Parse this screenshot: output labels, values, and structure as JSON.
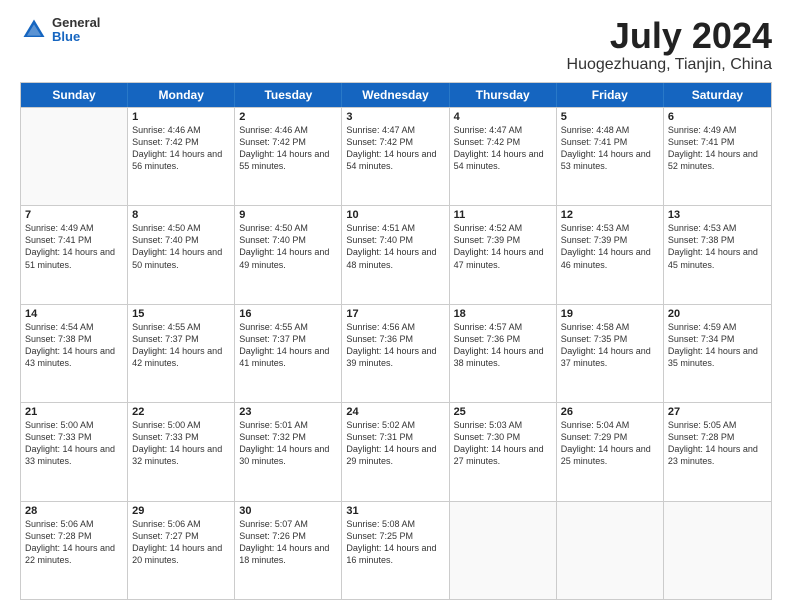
{
  "header": {
    "logo": {
      "general": "General",
      "blue": "Blue"
    },
    "title": "July 2024",
    "subtitle": "Huogezhuang, Tianjin, China"
  },
  "calendar": {
    "days": [
      "Sunday",
      "Monday",
      "Tuesday",
      "Wednesday",
      "Thursday",
      "Friday",
      "Saturday"
    ],
    "weeks": [
      [
        {
          "day": null,
          "sunrise": null,
          "sunset": null,
          "daylight": null
        },
        {
          "day": "1",
          "sunrise": "4:46 AM",
          "sunset": "7:42 PM",
          "daylight": "14 hours and 56 minutes."
        },
        {
          "day": "2",
          "sunrise": "4:46 AM",
          "sunset": "7:42 PM",
          "daylight": "14 hours and 55 minutes."
        },
        {
          "day": "3",
          "sunrise": "4:47 AM",
          "sunset": "7:42 PM",
          "daylight": "14 hours and 54 minutes."
        },
        {
          "day": "4",
          "sunrise": "4:47 AM",
          "sunset": "7:42 PM",
          "daylight": "14 hours and 54 minutes."
        },
        {
          "day": "5",
          "sunrise": "4:48 AM",
          "sunset": "7:41 PM",
          "daylight": "14 hours and 53 minutes."
        },
        {
          "day": "6",
          "sunrise": "4:49 AM",
          "sunset": "7:41 PM",
          "daylight": "14 hours and 52 minutes."
        }
      ],
      [
        {
          "day": "7",
          "sunrise": "4:49 AM",
          "sunset": "7:41 PM",
          "daylight": "14 hours and 51 minutes."
        },
        {
          "day": "8",
          "sunrise": "4:50 AM",
          "sunset": "7:40 PM",
          "daylight": "14 hours and 50 minutes."
        },
        {
          "day": "9",
          "sunrise": "4:50 AM",
          "sunset": "7:40 PM",
          "daylight": "14 hours and 49 minutes."
        },
        {
          "day": "10",
          "sunrise": "4:51 AM",
          "sunset": "7:40 PM",
          "daylight": "14 hours and 48 minutes."
        },
        {
          "day": "11",
          "sunrise": "4:52 AM",
          "sunset": "7:39 PM",
          "daylight": "14 hours and 47 minutes."
        },
        {
          "day": "12",
          "sunrise": "4:53 AM",
          "sunset": "7:39 PM",
          "daylight": "14 hours and 46 minutes."
        },
        {
          "day": "13",
          "sunrise": "4:53 AM",
          "sunset": "7:38 PM",
          "daylight": "14 hours and 45 minutes."
        }
      ],
      [
        {
          "day": "14",
          "sunrise": "4:54 AM",
          "sunset": "7:38 PM",
          "daylight": "14 hours and 43 minutes."
        },
        {
          "day": "15",
          "sunrise": "4:55 AM",
          "sunset": "7:37 PM",
          "daylight": "14 hours and 42 minutes."
        },
        {
          "day": "16",
          "sunrise": "4:55 AM",
          "sunset": "7:37 PM",
          "daylight": "14 hours and 41 minutes."
        },
        {
          "day": "17",
          "sunrise": "4:56 AM",
          "sunset": "7:36 PM",
          "daylight": "14 hours and 39 minutes."
        },
        {
          "day": "18",
          "sunrise": "4:57 AM",
          "sunset": "7:36 PM",
          "daylight": "14 hours and 38 minutes."
        },
        {
          "day": "19",
          "sunrise": "4:58 AM",
          "sunset": "7:35 PM",
          "daylight": "14 hours and 37 minutes."
        },
        {
          "day": "20",
          "sunrise": "4:59 AM",
          "sunset": "7:34 PM",
          "daylight": "14 hours and 35 minutes."
        }
      ],
      [
        {
          "day": "21",
          "sunrise": "5:00 AM",
          "sunset": "7:33 PM",
          "daylight": "14 hours and 33 minutes."
        },
        {
          "day": "22",
          "sunrise": "5:00 AM",
          "sunset": "7:33 PM",
          "daylight": "14 hours and 32 minutes."
        },
        {
          "day": "23",
          "sunrise": "5:01 AM",
          "sunset": "7:32 PM",
          "daylight": "14 hours and 30 minutes."
        },
        {
          "day": "24",
          "sunrise": "5:02 AM",
          "sunset": "7:31 PM",
          "daylight": "14 hours and 29 minutes."
        },
        {
          "day": "25",
          "sunrise": "5:03 AM",
          "sunset": "7:30 PM",
          "daylight": "14 hours and 27 minutes."
        },
        {
          "day": "26",
          "sunrise": "5:04 AM",
          "sunset": "7:29 PM",
          "daylight": "14 hours and 25 minutes."
        },
        {
          "day": "27",
          "sunrise": "5:05 AM",
          "sunset": "7:28 PM",
          "daylight": "14 hours and 23 minutes."
        }
      ],
      [
        {
          "day": "28",
          "sunrise": "5:06 AM",
          "sunset": "7:28 PM",
          "daylight": "14 hours and 22 minutes."
        },
        {
          "day": "29",
          "sunrise": "5:06 AM",
          "sunset": "7:27 PM",
          "daylight": "14 hours and 20 minutes."
        },
        {
          "day": "30",
          "sunrise": "5:07 AM",
          "sunset": "7:26 PM",
          "daylight": "14 hours and 18 minutes."
        },
        {
          "day": "31",
          "sunrise": "5:08 AM",
          "sunset": "7:25 PM",
          "daylight": "14 hours and 16 minutes."
        },
        {
          "day": null,
          "sunrise": null,
          "sunset": null,
          "daylight": null
        },
        {
          "day": null,
          "sunrise": null,
          "sunset": null,
          "daylight": null
        },
        {
          "day": null,
          "sunrise": null,
          "sunset": null,
          "daylight": null
        }
      ]
    ]
  }
}
